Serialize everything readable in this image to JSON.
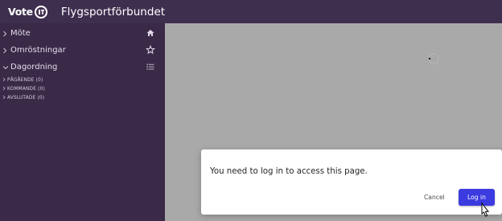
{
  "topbar": {
    "logo_text": "Vote",
    "org_name": "Flygsportförbundet"
  },
  "sidebar": {
    "items": [
      {
        "label": "Möte",
        "expanded": false,
        "icon": "home-icon"
      },
      {
        "label": "Omröstningar",
        "expanded": false,
        "icon": "star-icon"
      },
      {
        "label": "Dagordning",
        "expanded": true,
        "icon": "list-icon"
      }
    ],
    "subitems": [
      {
        "label": "PÅGÅENDE (0)"
      },
      {
        "label": "KOMMANDE (0)"
      },
      {
        "label": "AVSLUTADE (0)"
      }
    ]
  },
  "modal": {
    "message": "You need to log in to access this page.",
    "cancel_label": "Cancel",
    "login_label": "Log in"
  },
  "colors": {
    "topbar_bg": "#3f2f4f",
    "sidebar_bg": "#3a2a48",
    "main_bg": "#a9a9a9",
    "primary_button": "#3b3be0"
  }
}
